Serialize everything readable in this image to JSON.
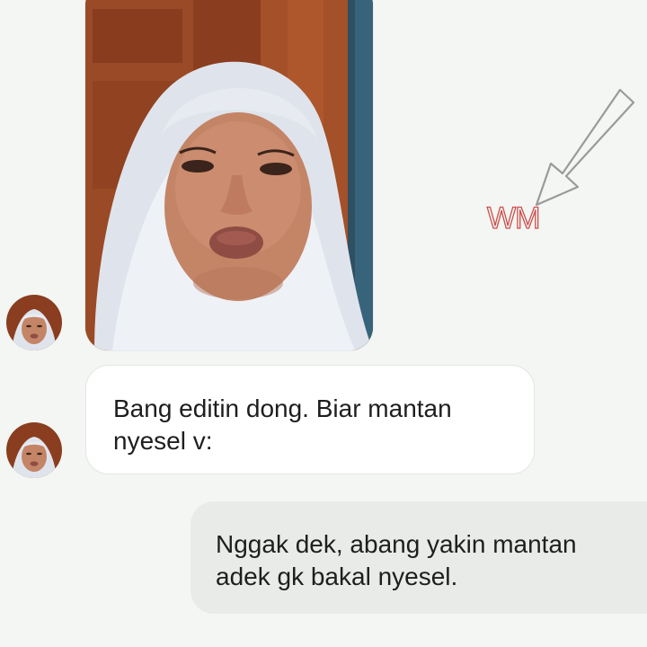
{
  "watermark": {
    "label": "WM",
    "color": "#cc4d4d"
  },
  "messages": [
    {
      "direction": "received",
      "kind": "photo",
      "avatar_icon": "contact-avatar-icon"
    },
    {
      "direction": "received",
      "kind": "text",
      "text": "Bang editin dong. Biar mantan\nnyesel v:",
      "avatar_icon": "contact-avatar-icon"
    },
    {
      "direction": "sent",
      "kind": "text",
      "text": "Nggak dek, abang yakin mantan\nadek gk bakal nyesel."
    }
  ],
  "colors": {
    "background": "#f3f6f2",
    "received_bubble": "#ffffff",
    "sent_bubble": "#e8ebe8",
    "text": "#1e1e1e"
  }
}
